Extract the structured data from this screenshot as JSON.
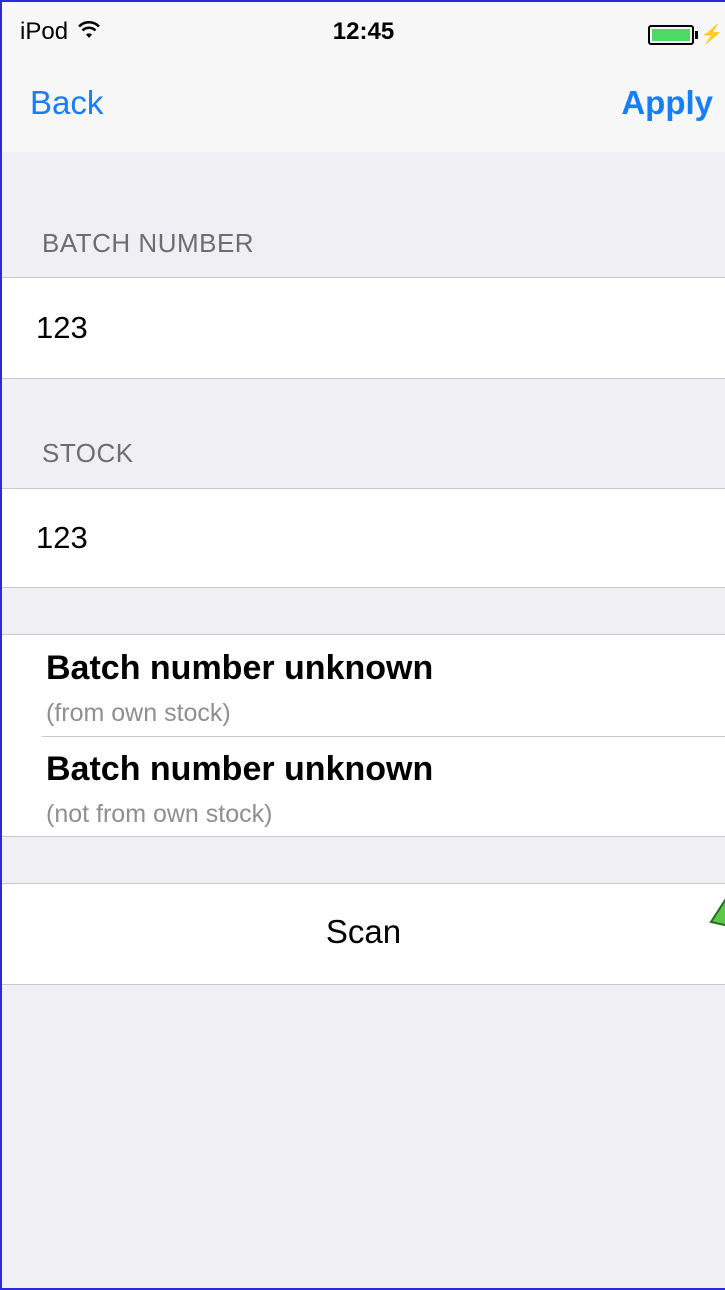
{
  "status_bar": {
    "carrier": "iPod",
    "time": "12:45",
    "wifi_icon": "wifi-icon",
    "battery_icon": "battery-icon"
  },
  "nav": {
    "back_label": "Back",
    "apply_label": "Apply"
  },
  "batch_section": {
    "header": "BATCH NUMBER",
    "value": "123"
  },
  "stock_section": {
    "header": "STOCK",
    "value": "123"
  },
  "options": [
    {
      "title": "Batch number unknown",
      "subtitle": "(from own stock)"
    },
    {
      "title": "Batch number unknown",
      "subtitle": "(not from own stock)"
    }
  ],
  "scan": {
    "label": "Scan"
  },
  "colors": {
    "accent": "#147efb",
    "background": "#efeff4",
    "battery": "#4cd964",
    "arrow": "#5cc84a"
  }
}
